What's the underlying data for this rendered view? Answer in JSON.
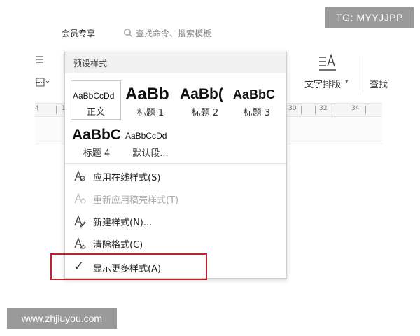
{
  "badge": {
    "text": "TG: MYYJJPP"
  },
  "watermark": {
    "text": "www.zhjiuyou.com"
  },
  "toolbar": {
    "member_label": "会员专享",
    "search_placeholder": "查找命令、搜索模板",
    "text_layout_label": "文字排版",
    "find_label": "查找"
  },
  "ruler": {
    "labels": [
      "30",
      "32",
      "34"
    ],
    "left_fragments": [
      "4",
      "1"
    ]
  },
  "dropdown": {
    "header": "预设样式",
    "styles": [
      {
        "sample": "AaBbCcDd",
        "name": "正文"
      },
      {
        "sample": "AaBb",
        "name": "标题 1"
      },
      {
        "sample": "AaBb(",
        "name": "标题 2"
      },
      {
        "sample": "AaBbC",
        "name": "标题 3"
      },
      {
        "sample": "AaBbC",
        "name": "标题 4"
      },
      {
        "sample": "AaBbCcDd",
        "name": "默认段..."
      }
    ],
    "menu": [
      {
        "label": "应用在线样式(S)"
      },
      {
        "label": "重新应用稿壳样式(T)"
      },
      {
        "label": "新建样式(N)..."
      },
      {
        "label": "清除格式(C)"
      },
      {
        "label": "显示更多样式(A)"
      }
    ]
  },
  "colors": {
    "highlight": "#c0222e",
    "badge_bg": "#9a9a9a"
  }
}
